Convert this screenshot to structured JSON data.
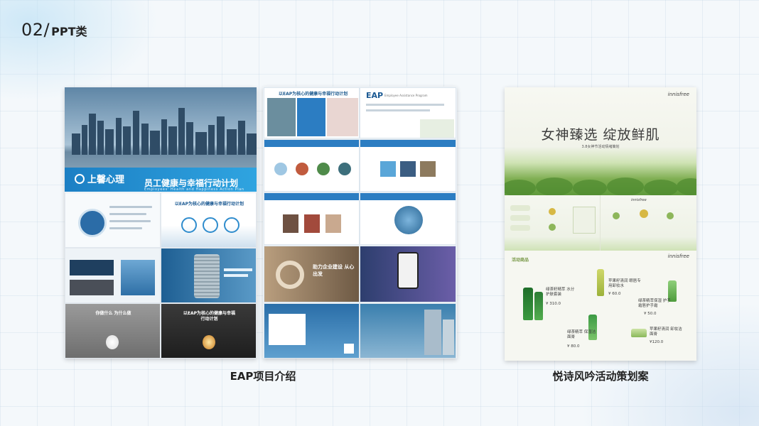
{
  "header": {
    "number": "02/",
    "category": "PPT类"
  },
  "card_eap": {
    "brand_name": "上馨心理",
    "cover_title": "员工健康与幸福行动计划",
    "cover_title_en": "Employees' Health and Happiness Action Plan",
    "slide_title": "以EAP为核心的健康与幸福行动计划",
    "dark_slide_title": "以EAP为核心的健康与幸福行动计划",
    "bulb_text": "你做什么 为什么做"
  },
  "card_eap_detail": {
    "top_title": "以EAP为核心的健康与幸福行动计划",
    "eap_label": "EAP",
    "eap_sub": "Employee Assistance Program",
    "slogan": "助力企业建设 从心出发"
  },
  "card_innisfree": {
    "brand": "innisfree",
    "title": "女神臻选 绽放鲜肌",
    "subtitle": "3.8女神节活动情绪策划",
    "section_label": "活动商品",
    "products": [
      {
        "name": "绿茶籽精萃 水分护肤套装",
        "price": "¥ 310.0"
      },
      {
        "name": "苹果籽清润 眼唇专用卸妆水",
        "price": "¥ 60.0"
      },
      {
        "name": "绿茶精萃保湿 护手霜唇护手霜",
        "price": "¥ 50.0"
      },
      {
        "name": "绿茶精萃 保湿洁面膏",
        "price": "¥ 80.0"
      },
      {
        "name": "苹果籽清润 卸妆洁面膏",
        "price": "¥120.0"
      }
    ]
  },
  "captions": {
    "left": "EAP项目介绍",
    "right": "悦诗风吟活动策划案"
  },
  "colors": {
    "eap_blue": "#1c7fc4",
    "innisfree_green": "#5f9a3c"
  }
}
